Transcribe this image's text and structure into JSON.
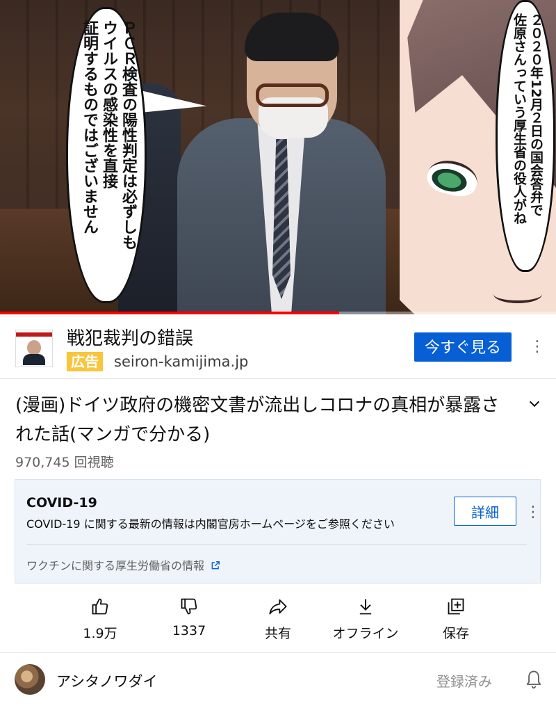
{
  "video": {
    "bubble_left": [
      "ＰＣＲ検査の陽性判定は必ずしも",
      "ウイルスの感染性を直接",
      "証明するものではございません"
    ],
    "bubble_right": [
      "２０２０年12月２日の国会答弁で",
      "佐原さんっていう厚生省の役人がね"
    ],
    "progress_fraction": 0.61
  },
  "ad": {
    "title": "戦犯裁判の錯誤",
    "badge": "広告",
    "domain": "seiron-kamijima.jp",
    "cta": "今すぐ見る",
    "menu_icon": "more-vert-icon"
  },
  "video_info": {
    "title": "(漫画)ドイツ政府の機密文書が流出しコロナの真相が暴露された話(マンガで分かる)",
    "views": "970,745 回視聴"
  },
  "info_panel": {
    "title": "COVID-19",
    "description": "COVID-19 に関する最新の情報は内閣官房ホームページをご参照ください",
    "button": "詳細",
    "link": "ワクチンに関する厚生労働省の情報"
  },
  "actions": [
    {
      "icon": "thumbs-up-icon",
      "label": "1.9万"
    },
    {
      "icon": "thumbs-down-icon",
      "label": "1337"
    },
    {
      "icon": "share-icon",
      "label": "共有"
    },
    {
      "icon": "download-icon",
      "label": "オフライン"
    },
    {
      "icon": "save-playlist-icon",
      "label": "保存"
    }
  ],
  "channel": {
    "name": "アシタノワダイ",
    "subscribe_state": "登録済み"
  },
  "colors": {
    "accent": "#065fd4",
    "progress": "#ff0000",
    "ad_badge": "#f8c53c"
  }
}
